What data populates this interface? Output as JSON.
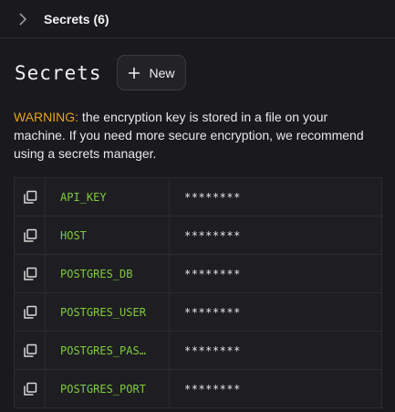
{
  "header": {
    "title": "Secrets (6)"
  },
  "page": {
    "title": "Secrets",
    "new_label": "New"
  },
  "warning": {
    "label": "WARNING:",
    "text": " the encryption key is stored in a file on your machine. If you need more secure encryption, we recommend using a secrets manager."
  },
  "secrets": [
    {
      "key": "API_KEY",
      "value": "********"
    },
    {
      "key": "HOST",
      "value": "********"
    },
    {
      "key": "POSTGRES_DB",
      "value": "********"
    },
    {
      "key": "POSTGRES_USER",
      "value": "********"
    },
    {
      "key": "POSTGRES_PAS…",
      "value": "********"
    },
    {
      "key": "POSTGRES_PORT",
      "value": "********"
    }
  ],
  "colors": {
    "background": "#1a1a1e",
    "warning": "#e8a21e",
    "key": "#7fcb3c"
  },
  "icons": {
    "expand": "chevron-right-icon",
    "new": "plus-icon",
    "copy": "copy-icon"
  }
}
